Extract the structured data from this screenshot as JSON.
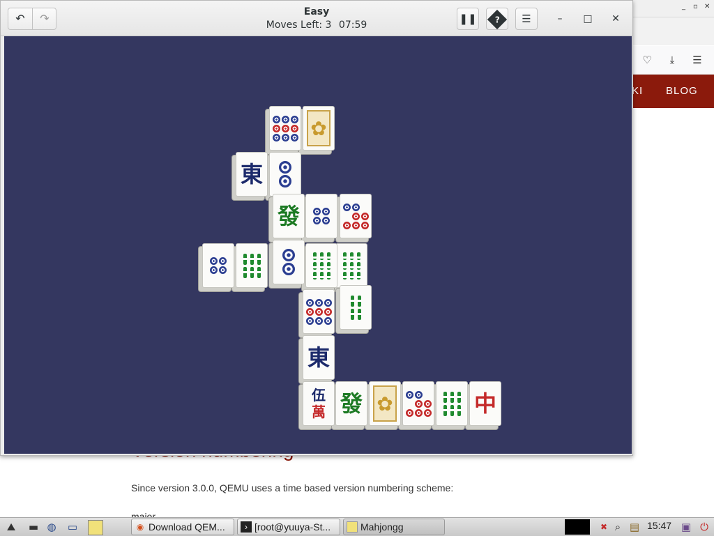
{
  "browser": {
    "nav_items": [
      "KI",
      "BLOG"
    ],
    "heading": "Version numbering",
    "paragraph": "Since version 3.0.0, QEMU uses a time based version numbering scheme:",
    "paragraph2": "major",
    "toolbar_icons": [
      "pocket-icon",
      "download-icon",
      "menu-icon"
    ]
  },
  "mahjongg": {
    "title": "Easy",
    "moves_label": "Moves Left:",
    "moves_left": "3",
    "timer": "07:59",
    "buttons": {
      "undo": "↶",
      "redo": "↷",
      "pause": "❚❚",
      "hint": "?",
      "menu": "☰",
      "minimize": "–",
      "maximize": "□",
      "close": "✕"
    },
    "tiles": [
      {
        "id": "t1",
        "kind": "dots",
        "count": 9
      },
      {
        "id": "t2",
        "kind": "flower"
      },
      {
        "id": "t3",
        "kind": "char",
        "glyph": "東",
        "color": "#1c2a6b"
      },
      {
        "id": "t4",
        "kind": "dots",
        "count": 2
      },
      {
        "id": "t5",
        "kind": "char",
        "glyph": "發",
        "color": "#1c7a23"
      },
      {
        "id": "t6",
        "kind": "dots",
        "count": 4
      },
      {
        "id": "t7",
        "kind": "dots",
        "count": 5
      },
      {
        "id": "t8",
        "kind": "dots",
        "count": 4
      },
      {
        "id": "t9",
        "kind": "bamboo",
        "count": 6
      },
      {
        "id": "t10",
        "kind": "dots",
        "count": 2
      },
      {
        "id": "t11",
        "kind": "bamboo",
        "count": 9
      },
      {
        "id": "t12",
        "kind": "bamboo",
        "count": 9
      },
      {
        "id": "t13",
        "kind": "dots",
        "count": 9
      },
      {
        "id": "t14",
        "kind": "bamboo",
        "count": 4
      },
      {
        "id": "t15",
        "kind": "char",
        "glyph": "東",
        "color": "#1c2a6b"
      },
      {
        "id": "t16",
        "kind": "char",
        "glyph": "伍\n萬",
        "color": "#c42a2a"
      },
      {
        "id": "t17",
        "kind": "char",
        "glyph": "發",
        "color": "#1c7a23"
      },
      {
        "id": "t18",
        "kind": "flower"
      },
      {
        "id": "t19",
        "kind": "dots",
        "count": 5
      },
      {
        "id": "t20",
        "kind": "bamboo",
        "count": 6
      },
      {
        "id": "t21",
        "kind": "char",
        "glyph": "中",
        "color": "#c42a2a"
      }
    ]
  },
  "taskbar": {
    "tasks": [
      "Download QEM...",
      "[root@yuuya-St...",
      "Mahjongg"
    ],
    "clock": "15:47"
  }
}
